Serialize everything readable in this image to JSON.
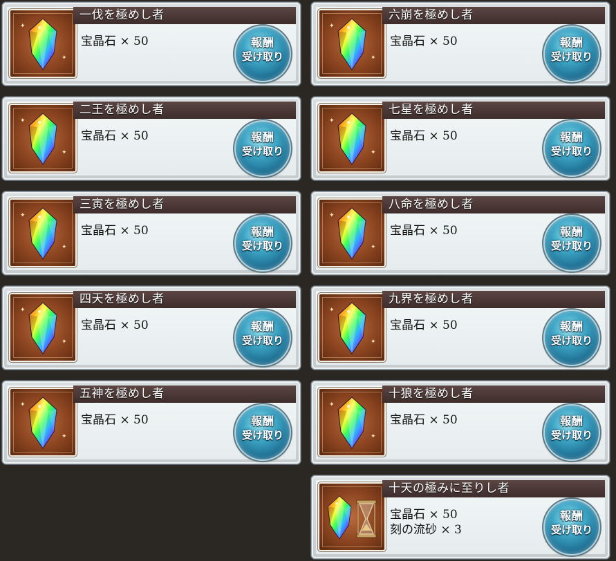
{
  "colors": {
    "accent": "#2f8fb4",
    "title_bar": "#4a3836",
    "background": "#2b2723"
  },
  "icons": {
    "item": "rainbow-crystal-icon",
    "hourglass": "hourglass-icon"
  },
  "cards": [
    {
      "title": "一伐を極めし者",
      "line1": "宝晶石 × 50",
      "line2": "",
      "button_top": "報酬",
      "button_bottom": "受け取り"
    },
    {
      "title": "六崩を極めし者",
      "line1": "宝晶石 × 50",
      "line2": "",
      "button_top": "報酬",
      "button_bottom": "受け取り"
    },
    {
      "title": "二王を極めし者",
      "line1": "宝晶石 × 50",
      "line2": "",
      "button_top": "報酬",
      "button_bottom": "受け取り"
    },
    {
      "title": "七星を極めし者",
      "line1": "宝晶石 × 50",
      "line2": "",
      "button_top": "報酬",
      "button_bottom": "受け取り"
    },
    {
      "title": "三寅を極めし者",
      "line1": "宝晶石 × 50",
      "line2": "",
      "button_top": "報酬",
      "button_bottom": "受け取り"
    },
    {
      "title": "八命を極めし者",
      "line1": "宝晶石 × 50",
      "line2": "",
      "button_top": "報酬",
      "button_bottom": "受け取り"
    },
    {
      "title": "四天を極めし者",
      "line1": "宝晶石 × 50",
      "line2": "",
      "button_top": "報酬",
      "button_bottom": "受け取り"
    },
    {
      "title": "九界を極めし者",
      "line1": "宝晶石 × 50",
      "line2": "",
      "button_top": "報酬",
      "button_bottom": "受け取り"
    },
    {
      "title": "五神を極めし者",
      "line1": "宝晶石 × 50",
      "line2": "",
      "button_top": "報酬",
      "button_bottom": "受け取り"
    },
    {
      "title": "十狼を極めし者",
      "line1": "宝晶石 × 50",
      "line2": "",
      "button_top": "報酬",
      "button_bottom": "受け取り"
    },
    {
      "title": "十天の極みに至りし者",
      "line1": "宝晶石 × 50",
      "line2": "刻の流砂 × 3",
      "button_top": "報酬",
      "button_bottom": "受け取り"
    }
  ]
}
